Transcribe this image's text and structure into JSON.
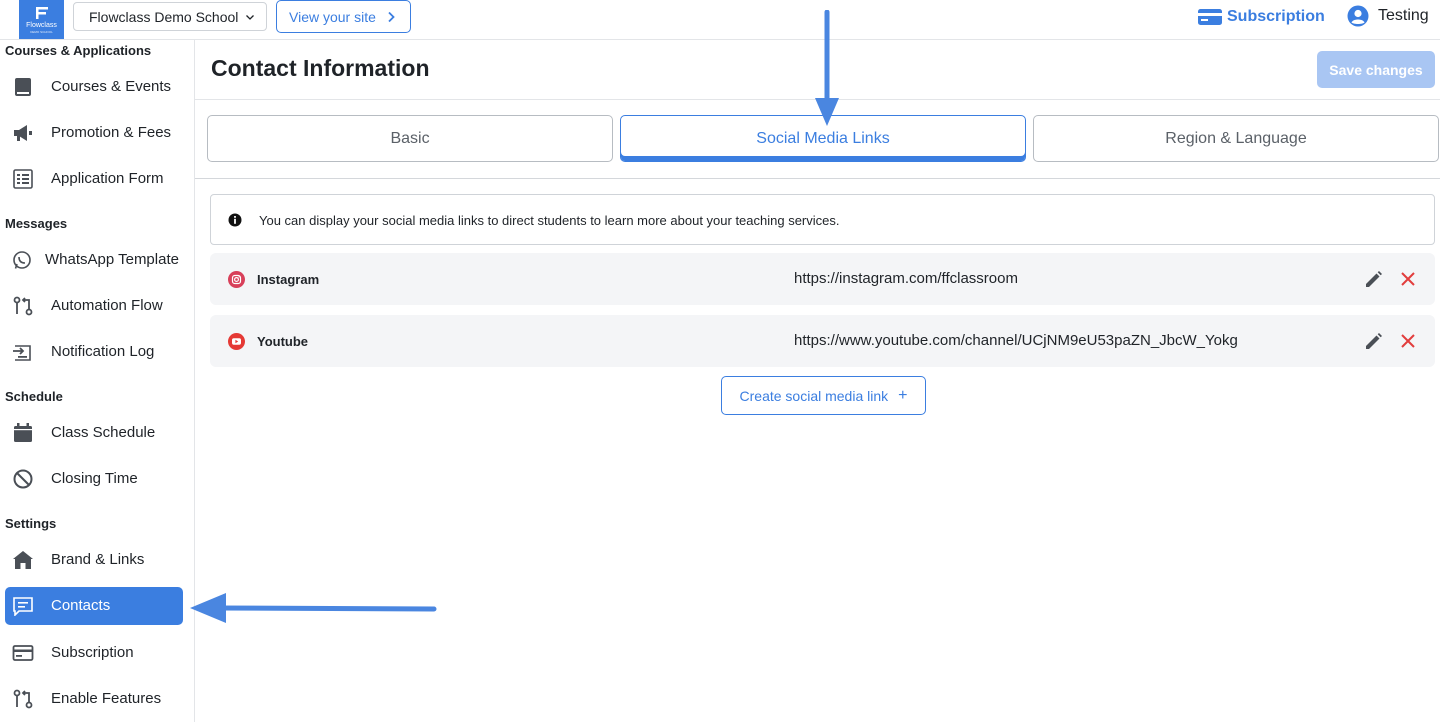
{
  "topbar": {
    "logo_word": "Flowclass",
    "logo_sub": "DEMO SCHOOL",
    "school_name": "Flowclass Demo School",
    "view_site_label": "View your site",
    "subscription_label": "Subscription",
    "user_name": "Testing"
  },
  "sidebar": {
    "sections": [
      {
        "title": "Courses & Applications"
      },
      {
        "title": "Messages"
      },
      {
        "title": "Schedule"
      },
      {
        "title": "Settings"
      }
    ],
    "items": [
      {
        "label": "Courses & Events",
        "icon": "book-icon"
      },
      {
        "label": "Promotion & Fees",
        "icon": "megaphone-icon"
      },
      {
        "label": "Application Form",
        "icon": "form-icon"
      },
      {
        "label": "WhatsApp Template",
        "icon": "whatsapp-icon"
      },
      {
        "label": "Automation Flow",
        "icon": "flow-icon"
      },
      {
        "label": "Notification Log",
        "icon": "notification-log-icon"
      },
      {
        "label": "Class Schedule",
        "icon": "calendar-icon"
      },
      {
        "label": "Closing Time",
        "icon": "block-icon"
      },
      {
        "label": "Brand & Links",
        "icon": "home-icon"
      },
      {
        "label": "Contacts",
        "icon": "chat-icon",
        "active": true
      },
      {
        "label": "Subscription",
        "icon": "card-icon"
      },
      {
        "label": "Enable Features",
        "icon": "flow-icon"
      }
    ]
  },
  "main": {
    "title": "Contact Information",
    "save_label": "Save changes",
    "tabs": [
      {
        "label": "Basic"
      },
      {
        "label": "Social Media Links",
        "active": true
      },
      {
        "label": "Region & Language"
      }
    ],
    "info_text": "You can display your social media links to direct students to learn more about your teaching services.",
    "links": [
      {
        "name": "Instagram",
        "url": "https://instagram.com/ffclassroom",
        "icon": "instagram-icon"
      },
      {
        "name": "Youtube",
        "url": "https://www.youtube.com/channel/UCjNM9eU53paZN_JbcW_Yokg",
        "icon": "youtube-icon"
      }
    ],
    "create_label": "Create social media link",
    "create_plus": "+"
  },
  "colors": {
    "accent": "#3b7ee0",
    "save_disabled": "#a9c6f3",
    "delete": "#e23d3d",
    "instagram": "#d8405a",
    "youtube": "#e53935"
  }
}
